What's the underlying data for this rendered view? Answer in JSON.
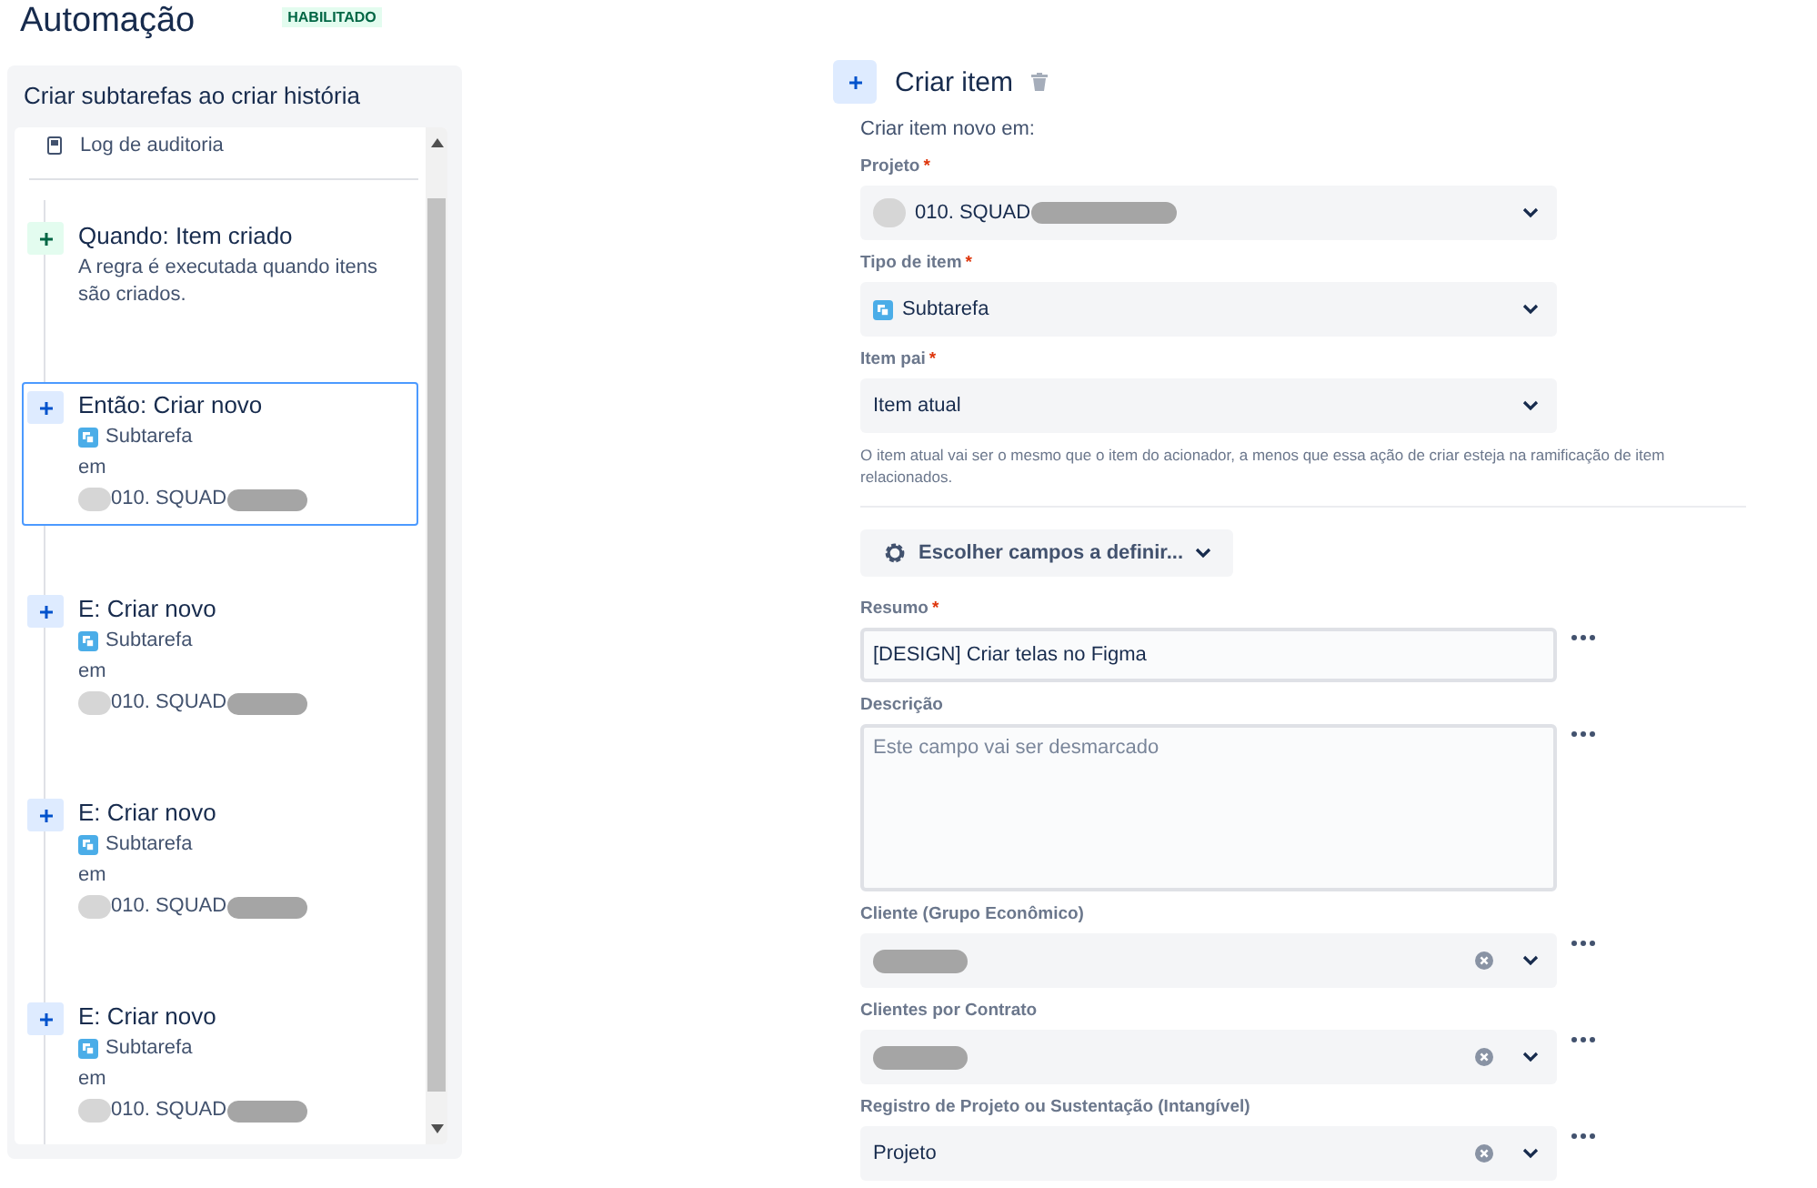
{
  "header": {
    "title": "Automação",
    "status": "HABILITADO"
  },
  "rule": {
    "name": "Criar subtarefas ao criar história",
    "audit_log": "Log de auditoria",
    "steps": [
      {
        "kind": "trigger",
        "title": "Quando: Item criado",
        "description": "A regra é executada quando itens são criados.",
        "selected": false
      },
      {
        "kind": "action",
        "title": "Então: Criar novo",
        "issue_type": "Subtarefa",
        "preposition": "em",
        "project": "010. SQUAD",
        "selected": true
      },
      {
        "kind": "action",
        "title": "E: Criar novo",
        "issue_type": "Subtarefa",
        "preposition": "em",
        "project": "010. SQUAD",
        "selected": false
      },
      {
        "kind": "action",
        "title": "E: Criar novo",
        "issue_type": "Subtarefa",
        "preposition": "em",
        "project": "010. SQUAD",
        "selected": false
      },
      {
        "kind": "action",
        "title": "E: Criar novo",
        "issue_type": "Subtarefa",
        "preposition": "em",
        "project": "010. SQUAD",
        "selected": false
      }
    ]
  },
  "form": {
    "title": "Criar item",
    "subtitle": "Criar item novo em:",
    "required_marker": "*",
    "fields": [
      {
        "kind": "project",
        "label": "Projeto",
        "required": true,
        "value": "010. SQUAD"
      },
      {
        "kind": "issuetype",
        "label": "Tipo de item",
        "required": true,
        "value": "Subtarefa"
      },
      {
        "kind": "select",
        "label": "Item pai",
        "required": true,
        "value": "Item atual",
        "help": "O item atual vai ser o mesmo que o item do acionador, a menos que essa ação de criar esteja na ramificação de item relacionados."
      },
      {
        "kind": "fields-button",
        "label": "Escolher campos a definir..."
      },
      {
        "kind": "text",
        "label": "Resumo",
        "required": true,
        "value": "[DESIGN] Criar telas no Figma"
      },
      {
        "kind": "textarea",
        "label": "Descrição",
        "required": false,
        "placeholder": "Este campo vai ser desmarcado"
      },
      {
        "kind": "clearable",
        "label": "Cliente (Grupo Econômico)",
        "required": false
      },
      {
        "kind": "clearable",
        "label": "Clientes por Contrato",
        "required": false
      },
      {
        "kind": "clearable",
        "label": "Registro de Projeto ou Sustentação (Intangível)",
        "required": false,
        "value": "Projeto"
      }
    ]
  }
}
